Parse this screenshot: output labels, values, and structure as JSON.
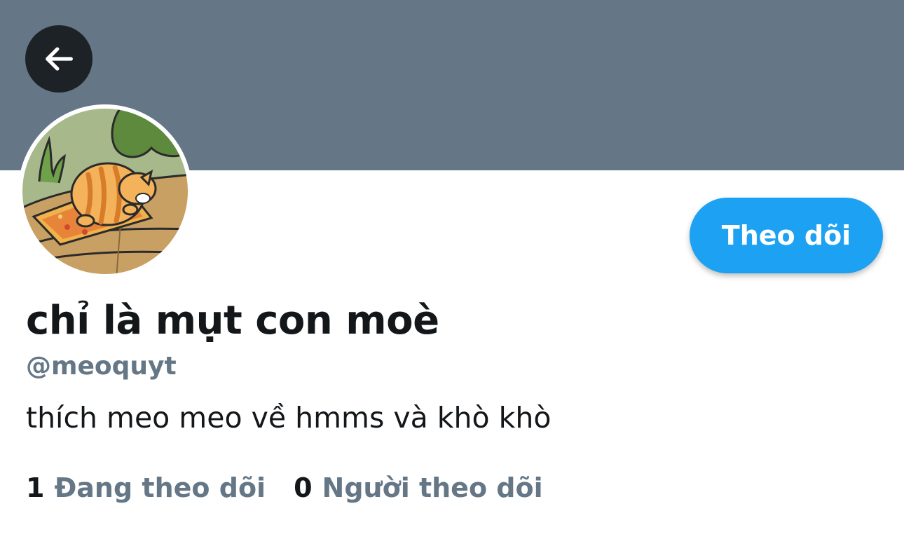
{
  "profile": {
    "display_name": "chỉ là mụt con moè",
    "handle": "@meoquyt",
    "bio": "thích meo meo về hmms và khò khò",
    "follow_label": "Theo dõi"
  },
  "stats": {
    "following_count": "1",
    "following_label": "Đang theo dõi",
    "followers_count": "0",
    "followers_label": "Người theo dõi"
  },
  "icons": {
    "back": "arrow-left-icon",
    "avatar": "sleeping-cat-avatar"
  },
  "colors": {
    "banner": "#657786",
    "accent": "#1da1f2",
    "text": "#14171a",
    "secondary_text": "#657786",
    "back_button": "#1d2226"
  }
}
